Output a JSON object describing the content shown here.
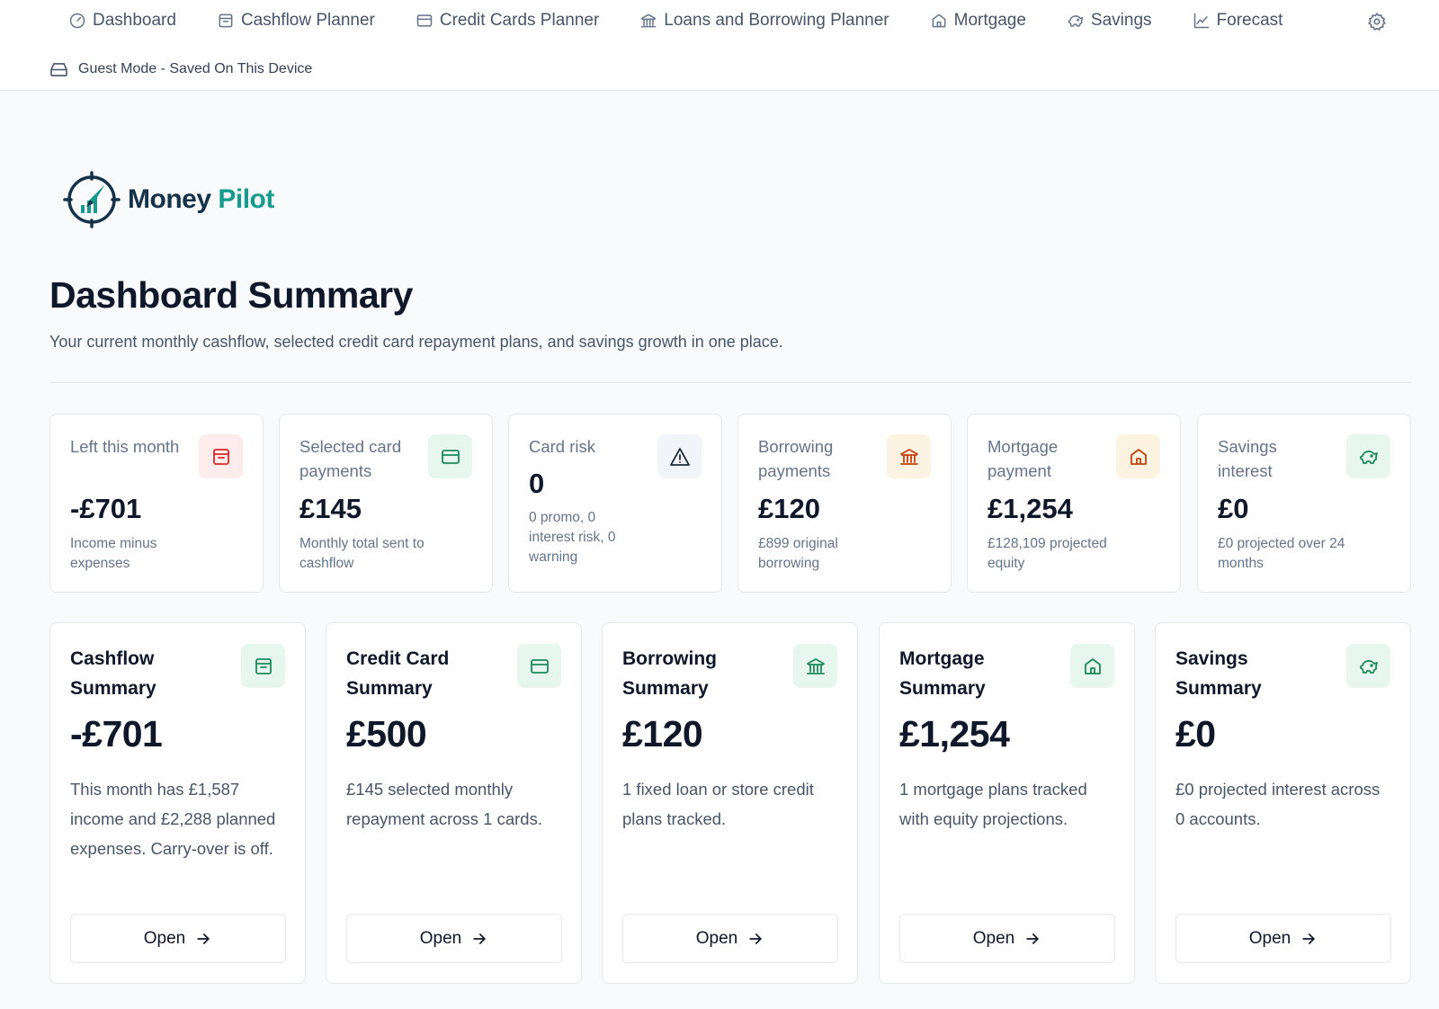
{
  "nav": {
    "items": [
      {
        "label": "Dashboard",
        "icon": "gauge-icon"
      },
      {
        "label": "Cashflow Planner",
        "icon": "wallet-icon"
      },
      {
        "label": "Credit Cards Planner",
        "icon": "credit-card-icon"
      },
      {
        "label": "Loans and Borrowing Planner",
        "icon": "bank-icon"
      },
      {
        "label": "Mortgage",
        "icon": "house-icon"
      },
      {
        "label": "Savings",
        "icon": "piggy-bank-icon"
      },
      {
        "label": "Forecast",
        "icon": "line-chart-icon"
      }
    ],
    "settings_icon": "gear-icon"
  },
  "guest_mode": {
    "label": "Guest Mode - Saved On This Device",
    "icon": "hard-drive-icon"
  },
  "logo": {
    "part1": "Money",
    "part2": "Pilot",
    "colors": {
      "dark": "#14324a",
      "accent": "#169b8e"
    }
  },
  "page": {
    "title": "Dashboard Summary",
    "subtitle": "Your current monthly cashflow, selected credit card repayment plans, and savings growth in one place."
  },
  "stats": [
    {
      "label": "Left this month",
      "value": "-£701",
      "note": "Income minus expenses",
      "icon": "wallet-icon",
      "tint": "#fdecec",
      "color": "#dc2626"
    },
    {
      "label": "Selected card payments",
      "value": "£145",
      "note": "Monthly total sent to cashflow",
      "icon": "credit-card-icon",
      "tint": "#e8f6f0",
      "color": "#1a8a5a"
    },
    {
      "label": "Card risk",
      "value": "0",
      "note": "0 promo, 0 interest risk, 0 warning",
      "icon": "warning-icon",
      "tint": "#f1f5f9",
      "color": "#1e293b"
    },
    {
      "label": "Borrowing payments",
      "value": "£120",
      "note": "£899 original borrowing",
      "icon": "bank-icon",
      "tint": "#fdf3e3",
      "color": "#c2410c"
    },
    {
      "label": "Mortgage payment",
      "value": "£1,254",
      "note": "£128,109 projected equity",
      "icon": "house-icon",
      "tint": "#fdf3e3",
      "color": "#c2410c"
    },
    {
      "label": "Savings interest",
      "value": "£0",
      "note": "£0 projected over 24 months",
      "icon": "piggy-bank-icon",
      "tint": "#e8f6f0",
      "color": "#1a8a5a"
    }
  ],
  "cards": [
    {
      "title": "Cashflow Summary",
      "value": "-£701",
      "desc": "This month has £1,587 income and £2,288 planned expenses. Carry-over is off.",
      "icon": "wallet-icon",
      "button": "Open"
    },
    {
      "title": "Credit Card Summary",
      "value": "£500",
      "desc": "£145 selected monthly repayment across 1 cards.",
      "icon": "credit-card-icon",
      "button": "Open"
    },
    {
      "title": "Borrowing Summary",
      "value": "£120",
      "desc": "1 fixed loan or store credit plans tracked.",
      "icon": "bank-icon",
      "button": "Open"
    },
    {
      "title": "Mortgage Summary",
      "value": "£1,254",
      "desc": "1 mortgage plans tracked with equity projections.",
      "icon": "house-icon",
      "button": "Open"
    },
    {
      "title": "Savings Summary",
      "value": "£0",
      "desc": "£0 projected interest across 0 accounts.",
      "icon": "piggy-bank-icon",
      "button": "Open"
    }
  ]
}
